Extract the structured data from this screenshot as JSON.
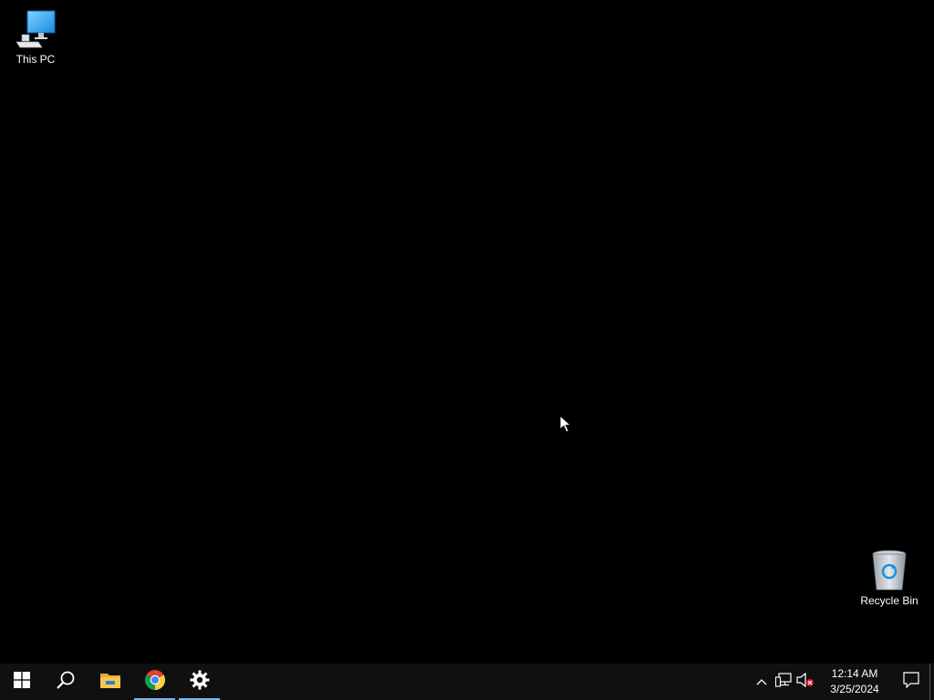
{
  "desktop": {
    "background_color": "#000000",
    "icons": [
      {
        "label": "This PC",
        "icon": "computer-icon"
      },
      {
        "label": "Recycle Bin",
        "icon": "recycle-bin-icon"
      }
    ]
  },
  "taskbar": {
    "background_color": "#101010",
    "accent_color": "#76b9ed",
    "pinned": [
      {
        "name": "start",
        "icon": "windows-logo-icon",
        "active": false
      },
      {
        "name": "search",
        "icon": "search-icon",
        "active": false
      },
      {
        "name": "file-explorer",
        "icon": "folder-icon",
        "active": false
      },
      {
        "name": "chrome",
        "icon": "chrome-icon",
        "active": true
      },
      {
        "name": "settings",
        "icon": "gear-icon",
        "active": true
      }
    ],
    "tray": {
      "icons": [
        "chevron-up-icon",
        "network-icon",
        "volume-muted-icon"
      ],
      "time": "12:14 AM",
      "date": "3/25/2024",
      "notification_icon": "action-center-icon"
    }
  }
}
